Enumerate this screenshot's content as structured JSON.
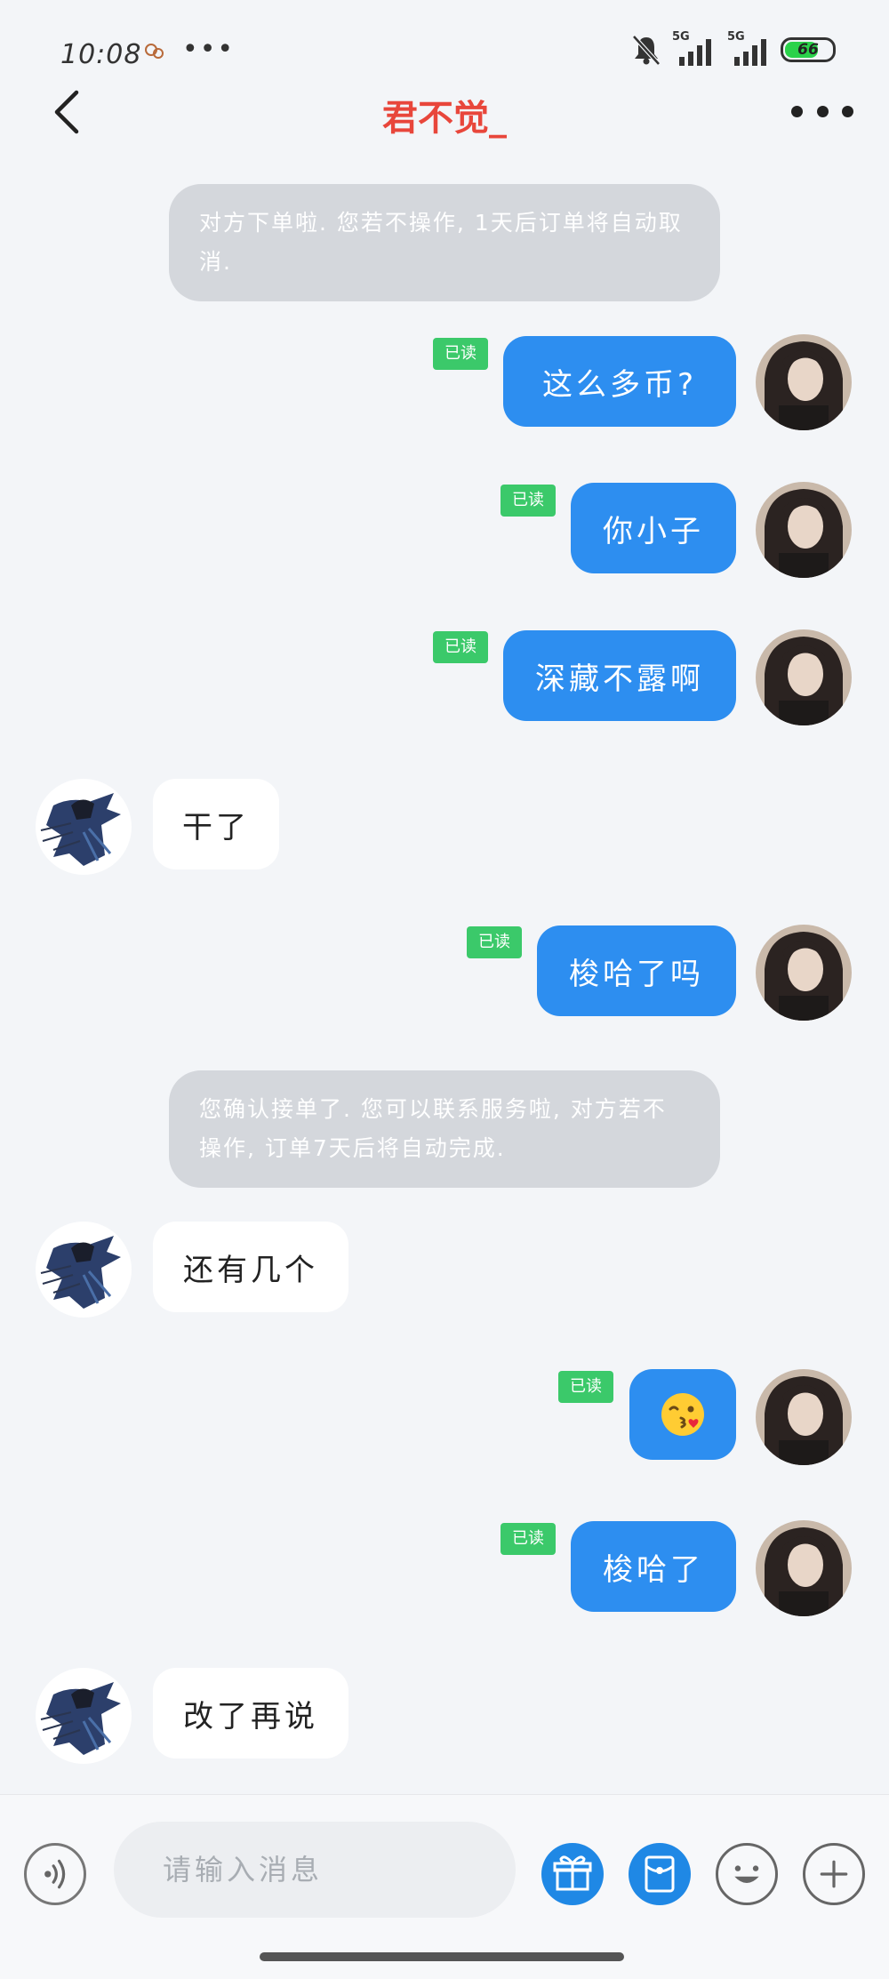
{
  "status_bar": {
    "time": "10:08",
    "dots": "•••",
    "signal_1_label": "5G",
    "signal_2_label": "5G",
    "battery": "66"
  },
  "header": {
    "title": "君不觉_"
  },
  "messages": [
    {
      "type": "system",
      "text": "对方下单啦. 您若不操作, 1天后订单将自动取消."
    },
    {
      "type": "me",
      "text": "这么多币?",
      "status": "已读"
    },
    {
      "type": "me",
      "text": "你小子",
      "status": "已读"
    },
    {
      "type": "me",
      "text": "深藏不露啊",
      "status": "已读"
    },
    {
      "type": "them",
      "text": "干了"
    },
    {
      "type": "me",
      "text": "梭哈了吗",
      "status": "已读"
    },
    {
      "type": "system",
      "text": "您确认接单了. 您可以联系服务啦, 对方若不操作, 订单7天后将自动完成."
    },
    {
      "type": "them",
      "text": "还有几个"
    },
    {
      "type": "me",
      "emoji": "kissing-face-emoji",
      "status": "已读"
    },
    {
      "type": "me",
      "text": "梭哈了",
      "status": "已读"
    },
    {
      "type": "them",
      "text": "改了再说"
    }
  ],
  "input_bar": {
    "placeholder": "请输入消息"
  },
  "colors": {
    "accent": "#2d8ef0",
    "title": "#e8463b",
    "read_badge": "#3bc96a"
  }
}
